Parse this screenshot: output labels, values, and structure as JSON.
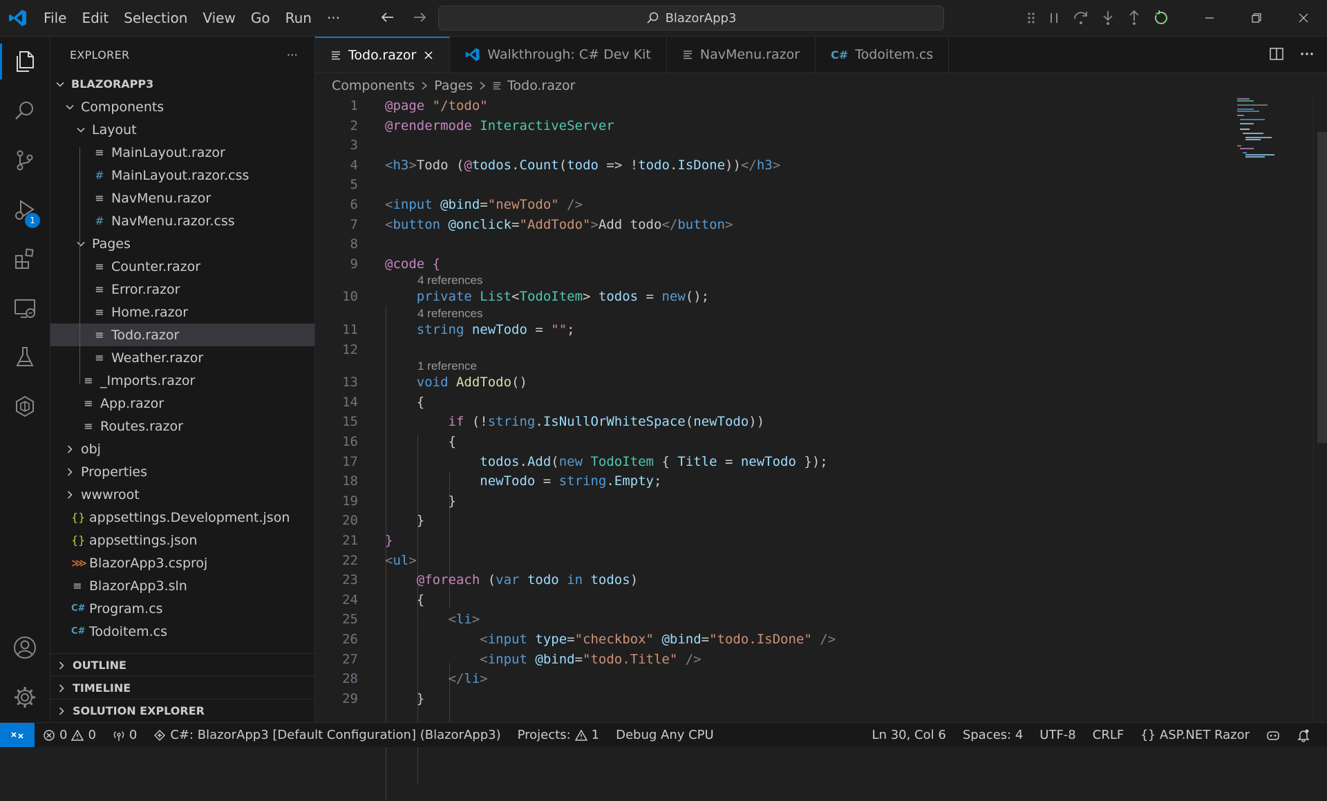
{
  "titlebar": {
    "menu": [
      "File",
      "Edit",
      "Selection",
      "View",
      "Go",
      "Run",
      "···"
    ],
    "search_text": "BlazorApp3"
  },
  "activitybar": {
    "items": [
      "explorer-icon",
      "search-icon",
      "source-control-icon",
      "run-debug-icon",
      "extensions-icon",
      "remote-explorer-icon",
      "testing-icon",
      "dotnet-icon"
    ],
    "debug_badge": "1",
    "bottom": [
      "account-icon",
      "settings-gear-icon"
    ]
  },
  "sidebar": {
    "title": "EXPLORER",
    "more": "···",
    "root": "BLAZORAPP3",
    "tree": [
      {
        "label": "Components",
        "type": "folder-open",
        "depth": 1
      },
      {
        "label": "Layout",
        "type": "folder-open",
        "depth": 2
      },
      {
        "label": "MainLayout.razor",
        "type": "razor",
        "depth": 3
      },
      {
        "label": "MainLayout.razor.css",
        "type": "css",
        "depth": 3
      },
      {
        "label": "NavMenu.razor",
        "type": "razor",
        "depth": 3
      },
      {
        "label": "NavMenu.razor.css",
        "type": "css",
        "depth": 3
      },
      {
        "label": "Pages",
        "type": "folder-open",
        "depth": 2
      },
      {
        "label": "Counter.razor",
        "type": "razor",
        "depth": 3
      },
      {
        "label": "Error.razor",
        "type": "razor",
        "depth": 3
      },
      {
        "label": "Home.razor",
        "type": "razor",
        "depth": 3
      },
      {
        "label": "Todo.razor",
        "type": "razor",
        "depth": 3,
        "selected": true
      },
      {
        "label": "Weather.razor",
        "type": "razor",
        "depth": 3
      },
      {
        "label": "_Imports.razor",
        "type": "razor",
        "depth": 2
      },
      {
        "label": "App.razor",
        "type": "razor",
        "depth": 2
      },
      {
        "label": "Routes.razor",
        "type": "razor",
        "depth": 2
      },
      {
        "label": "obj",
        "type": "folder",
        "depth": 1
      },
      {
        "label": "Properties",
        "type": "folder",
        "depth": 1
      },
      {
        "label": "wwwroot",
        "type": "folder",
        "depth": 1
      },
      {
        "label": "appsettings.Development.json",
        "type": "json",
        "depth": 1
      },
      {
        "label": "appsettings.json",
        "type": "json",
        "depth": 1
      },
      {
        "label": "BlazorApp3.csproj",
        "type": "csproj",
        "depth": 1
      },
      {
        "label": "BlazorApp3.sln",
        "type": "sln",
        "depth": 1
      },
      {
        "label": "Program.cs",
        "type": "cs",
        "depth": 1
      },
      {
        "label": "Todoitem.cs",
        "type": "cs",
        "depth": 1
      }
    ],
    "sections": [
      "OUTLINE",
      "TIMELINE",
      "SOLUTION EXPLORER"
    ]
  },
  "tabs": [
    {
      "label": "Todo.razor",
      "icon": "razor",
      "active": true
    },
    {
      "label": "Walkthrough: C# Dev Kit",
      "icon": "vscode"
    },
    {
      "label": "NavMenu.razor",
      "icon": "razor"
    },
    {
      "label": "Todoitem.cs",
      "icon": "cs"
    }
  ],
  "breadcrumb": [
    "Components",
    "Pages",
    "Todo.razor"
  ],
  "code": {
    "lines": [
      [
        [
          "t-dir",
          "@page "
        ],
        [
          "t-str",
          "\"/todo\""
        ]
      ],
      [
        [
          "t-dir",
          "@rendermode "
        ],
        [
          "t-type",
          "InteractiveServer"
        ]
      ],
      [],
      [
        [
          "t-br",
          "<"
        ],
        [
          "t-tag",
          "h3"
        ],
        [
          "t-br",
          ">"
        ],
        [
          "t-pl",
          "Todo ("
        ],
        [
          "t-dir",
          "@"
        ],
        [
          "t-var",
          "todos"
        ],
        [
          "t-pl",
          "."
        ],
        [
          "t-var",
          "Count"
        ],
        [
          "t-pl",
          "("
        ],
        [
          "t-var",
          "todo"
        ],
        [
          "t-pl",
          " => !"
        ],
        [
          "t-var",
          "todo"
        ],
        [
          "t-pl",
          "."
        ],
        [
          "t-var",
          "IsDone"
        ],
        [
          "t-pl",
          "))"
        ],
        [
          "t-br",
          "</"
        ],
        [
          "t-tag",
          "h3"
        ],
        [
          "t-br",
          ">"
        ]
      ],
      [],
      [
        [
          "t-br",
          "<"
        ],
        [
          "t-tag",
          "input"
        ],
        [
          "t-pl",
          " "
        ],
        [
          "t-attr",
          "@bind"
        ],
        [
          "t-pl",
          "="
        ],
        [
          "t-str",
          "\"newTodo\""
        ],
        [
          "t-pl",
          " "
        ],
        [
          "t-br",
          "/>"
        ]
      ],
      [
        [
          "t-br",
          "<"
        ],
        [
          "t-tag",
          "button"
        ],
        [
          "t-pl",
          " "
        ],
        [
          "t-attr",
          "@onclick"
        ],
        [
          "t-pl",
          "="
        ],
        [
          "t-str",
          "\"AddTodo\""
        ],
        [
          "t-br",
          ">"
        ],
        [
          "t-pl",
          "Add todo"
        ],
        [
          "t-br",
          "</"
        ],
        [
          "t-tag",
          "button"
        ],
        [
          "t-br",
          ">"
        ]
      ],
      [],
      [
        [
          "t-dir",
          "@code "
        ],
        [
          "t-ctl",
          "{"
        ]
      ],
      [
        [
          "t-pl",
          "    "
        ],
        [
          "t-kw",
          "private "
        ],
        [
          "t-type",
          "List"
        ],
        [
          "t-pl",
          "<"
        ],
        [
          "t-type",
          "TodoItem"
        ],
        [
          "t-pl",
          "> "
        ],
        [
          "t-var",
          "todos"
        ],
        [
          "t-pl",
          " = "
        ],
        [
          "t-kw",
          "new"
        ],
        [
          "t-pl",
          "();"
        ]
      ],
      [
        [
          "t-pl",
          "    "
        ],
        [
          "t-kw",
          "string "
        ],
        [
          "t-var",
          "newTodo"
        ],
        [
          "t-pl",
          " = "
        ],
        [
          "t-str",
          "\"\""
        ],
        [
          "t-pl",
          ";"
        ]
      ],
      [],
      [
        [
          "t-pl",
          "    "
        ],
        [
          "t-kw",
          "void "
        ],
        [
          "t-fn",
          "AddTodo"
        ],
        [
          "t-pl",
          "()"
        ]
      ],
      [
        [
          "t-pl",
          "    {"
        ]
      ],
      [
        [
          "t-pl",
          "        "
        ],
        [
          "t-ctl",
          "if "
        ],
        [
          "t-pl",
          "(!"
        ],
        [
          "t-kw",
          "string"
        ],
        [
          "t-pl",
          "."
        ],
        [
          "t-var",
          "IsNullOrWhiteSpace"
        ],
        [
          "t-pl",
          "("
        ],
        [
          "t-var",
          "newTodo"
        ],
        [
          "t-pl",
          "))"
        ]
      ],
      [
        [
          "t-pl",
          "        {"
        ]
      ],
      [
        [
          "t-pl",
          "            "
        ],
        [
          "t-var",
          "todos"
        ],
        [
          "t-pl",
          "."
        ],
        [
          "t-var",
          "Add"
        ],
        [
          "t-pl",
          "("
        ],
        [
          "t-kw",
          "new "
        ],
        [
          "t-type",
          "TodoItem"
        ],
        [
          "t-pl",
          " { "
        ],
        [
          "t-var",
          "Title"
        ],
        [
          "t-pl",
          " = "
        ],
        [
          "t-var",
          "newTodo"
        ],
        [
          "t-pl",
          " });"
        ]
      ],
      [
        [
          "t-pl",
          "            "
        ],
        [
          "t-var",
          "newTodo"
        ],
        [
          "t-pl",
          " = "
        ],
        [
          "t-kw",
          "string"
        ],
        [
          "t-pl",
          "."
        ],
        [
          "t-var",
          "Empty"
        ],
        [
          "t-pl",
          ";"
        ]
      ],
      [
        [
          "t-pl",
          "        }"
        ]
      ],
      [
        [
          "t-pl",
          "    }"
        ]
      ],
      [
        [
          "t-ctl",
          "}"
        ]
      ],
      [
        [
          "t-br",
          "<"
        ],
        [
          "t-tag",
          "ul"
        ],
        [
          "t-br",
          ">"
        ]
      ],
      [
        [
          "t-pl",
          "    "
        ],
        [
          "t-dir",
          "@foreach"
        ],
        [
          "t-pl",
          " ("
        ],
        [
          "t-kw",
          "var "
        ],
        [
          "t-var",
          "todo"
        ],
        [
          "t-pl",
          " "
        ],
        [
          "t-kw",
          "in "
        ],
        [
          "t-var",
          "todos"
        ],
        [
          "t-pl",
          ")"
        ]
      ],
      [
        [
          "t-pl",
          "    {"
        ]
      ],
      [
        [
          "t-pl",
          "        "
        ],
        [
          "t-br",
          "<"
        ],
        [
          "t-tag",
          "li"
        ],
        [
          "t-br",
          ">"
        ]
      ],
      [
        [
          "t-pl",
          "            "
        ],
        [
          "t-br",
          "<"
        ],
        [
          "t-tag",
          "input"
        ],
        [
          "t-pl",
          " "
        ],
        [
          "t-attr",
          "type"
        ],
        [
          "t-pl",
          "="
        ],
        [
          "t-str",
          "\"checkbox\""
        ],
        [
          "t-pl",
          " "
        ],
        [
          "t-attr",
          "@bind"
        ],
        [
          "t-pl",
          "="
        ],
        [
          "t-str",
          "\"todo.IsDone\""
        ],
        [
          "t-pl",
          " "
        ],
        [
          "t-br",
          "/>"
        ]
      ],
      [
        [
          "t-pl",
          "            "
        ],
        [
          "t-br",
          "<"
        ],
        [
          "t-tag",
          "input"
        ],
        [
          "t-pl",
          " "
        ],
        [
          "t-attr",
          "@bind"
        ],
        [
          "t-pl",
          "="
        ],
        [
          "t-str",
          "\"todo.Title\""
        ],
        [
          "t-pl",
          " "
        ],
        [
          "t-br",
          "/>"
        ]
      ],
      [
        [
          "t-pl",
          "        "
        ],
        [
          "t-br",
          "</"
        ],
        [
          "t-tag",
          "li"
        ],
        [
          "t-br",
          ">"
        ]
      ],
      [
        [
          "t-pl",
          "    }"
        ]
      ]
    ],
    "codelens": [
      {
        "before_line": 10,
        "text": "4 references"
      },
      {
        "before_line": 11,
        "text": "4 references"
      },
      {
        "before_line": 13,
        "text": "1 reference"
      }
    ]
  },
  "statusbar": {
    "errors": "0",
    "warnings": "0",
    "ports": "0",
    "project": "C#: BlazorApp3 [Default Configuration] (BlazorApp3)",
    "projects": "Projects:",
    "projects_count": "1",
    "debug": "Debug Any CPU",
    "position": "Ln 30, Col 6",
    "spaces": "Spaces: 4",
    "encoding": "UTF-8",
    "eol": "CRLF",
    "language": "ASP.NET Razor"
  },
  "colors": {
    "accent": "#0078d4",
    "background": "#1f1f1f",
    "sidebar": "#181818",
    "selection": "#37373d"
  }
}
